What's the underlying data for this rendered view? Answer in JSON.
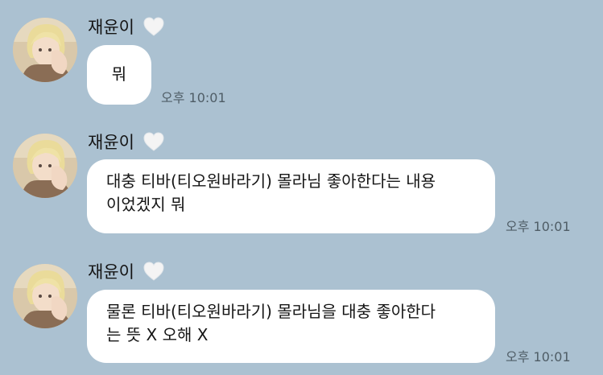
{
  "colors": {
    "background": "#abc1d1",
    "bubble": "#ffffff",
    "heart": "#f4f4f4"
  },
  "messages": [
    {
      "sender": "재윤이",
      "badge_icon": "white-heart-icon",
      "lines": [
        "뭐"
      ],
      "time": "오후 10:01"
    },
    {
      "sender": "재윤이",
      "badge_icon": "white-heart-icon",
      "lines": [
        "대충 티바(티오원바라기) 몰라님 좋아한다는 내용",
        "이었겠지 뭐"
      ],
      "time": "오후 10:01"
    },
    {
      "sender": "재윤이",
      "badge_icon": "white-heart-icon",
      "lines": [
        "물론 티바(티오원바라기) 몰라님을 대충 좋아한다",
        "는 뜻 X 오해 X"
      ],
      "time": "오후 10:01"
    }
  ]
}
